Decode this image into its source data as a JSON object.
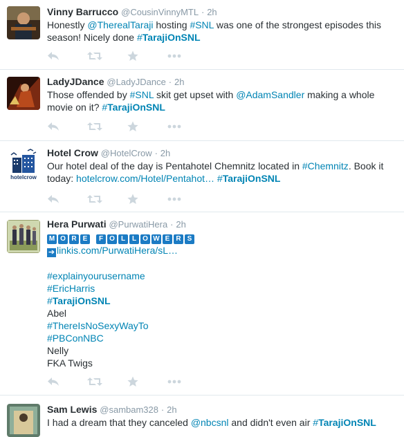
{
  "tweets": [
    {
      "name": "Vinny Barrucco",
      "handle": "@CousinVinnyMTL",
      "time": "2h",
      "text_parts": {
        "a": "Honestly ",
        "mention": "@TherealTaraji",
        "b": " hosting ",
        "snl": "#SNL",
        "c": " was one of the strongest episodes this season! Nicely done ",
        "hash_prefix": "#",
        "hash_bold": "TarajiOnSNL"
      }
    },
    {
      "name": "LadyJDance",
      "handle": "@LadyJDance",
      "time": "2h",
      "text_parts": {
        "a": "Those offended by ",
        "snl": "#SNL",
        "b": " skit get upset with ",
        "mention": "@AdamSandler",
        "c": " making a whole movie on it? ",
        "hash_prefix": "#",
        "hash_bold": "TarajiOnSNL"
      }
    },
    {
      "name": "Hotel Crow",
      "handle": "@HotelCrow",
      "time": "2h",
      "avatar_label": "hotelcrow",
      "text_parts": {
        "a": "Our hotel deal of the day is Pentahotel Chemnitz located in ",
        "tag": "#Chemnitz",
        "b": ". Book it today: ",
        "link": "hotelcrow.com/Hotel/Pentahot…",
        "hash_prefix": "#",
        "hash_bold": "TarajiOnSNL"
      }
    },
    {
      "name": "Hera Purwati",
      "handle": "@PurwatiHera",
      "time": "2h",
      "more_followers": [
        "M",
        "O",
        "R",
        "E",
        "F",
        "O",
        "L",
        "L",
        "O",
        "W",
        "E",
        "R",
        "S"
      ],
      "link": "linkis.com/PurwatiHera/sL…",
      "lines": {
        "l1": "#explainyourusername",
        "l2": "#EricHarris",
        "l3_prefix": "#",
        "l3_bold": "TarajiOnSNL",
        "l4": "Abel",
        "l5": "#ThereIsNoSexyWayTo",
        "l6": "#PBConNBC",
        "l7": "Nelly",
        "l8": "FKA Twigs"
      }
    },
    {
      "name": "Sam Lewis",
      "handle": "@sambam328",
      "time": "2h",
      "text_parts": {
        "a": "I had a dream that they canceled ",
        "mention": "@nbcsnl",
        "b": " and didn't even air ",
        "hash_prefix": "#",
        "hash_bold": "TarajiOnSNL"
      }
    }
  ],
  "separator": "·",
  "colors": {
    "link": "#0084b4",
    "muted": "#8899a6",
    "icon": "#ccd6dd",
    "text": "#292f33"
  },
  "icons": [
    "reply-icon",
    "retweet-icon",
    "favorite-icon",
    "more-icon"
  ]
}
